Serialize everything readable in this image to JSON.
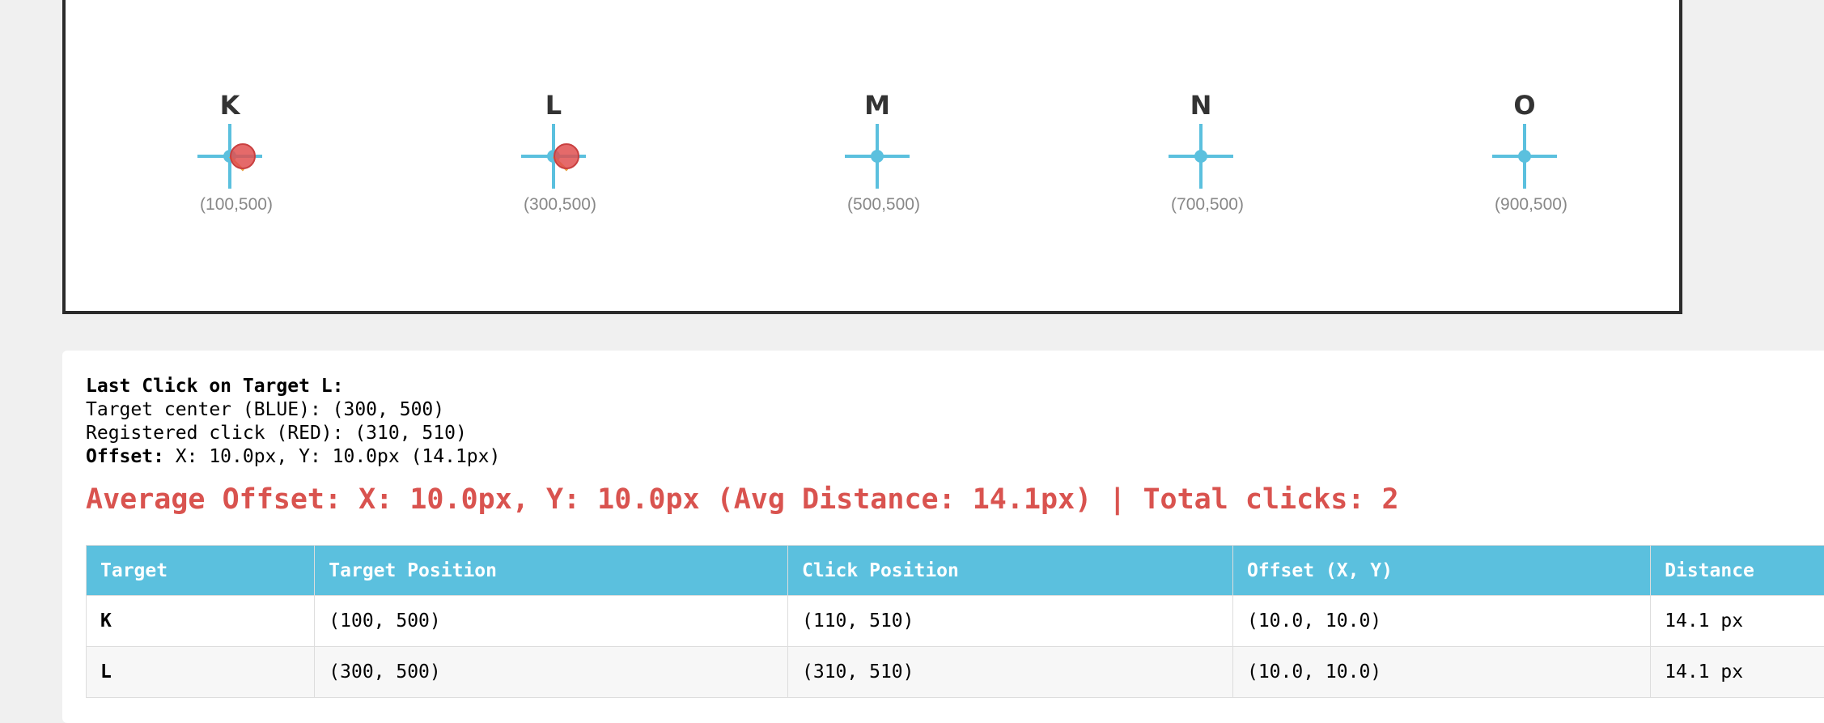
{
  "targets": [
    {
      "letter": "K",
      "coords": "(100,500)"
    },
    {
      "letter": "L",
      "coords": "(300,500)"
    },
    {
      "letter": "M",
      "coords": "(500,500)"
    },
    {
      "letter": "N",
      "coords": "(700,500)"
    },
    {
      "letter": "O",
      "coords": "(900,500)"
    }
  ],
  "colors": {
    "target": "#5bc0de",
    "click": "#e05050",
    "accent_red": "#d9534f",
    "header_bg": "#5bc0de"
  },
  "last_click": {
    "heading": "Last Click on Target L:",
    "target_center": "Target center (BLUE): (300, 500)",
    "registered_click": "Registered click (RED): (310, 510)",
    "offset_label": "Offset:",
    "offset_value": " X: 10.0px, Y: 10.0px (14.1px)"
  },
  "average": "Average Offset: X: 10.0px, Y: 10.0px (Avg Distance: 14.1px) | Total clicks: 2",
  "table": {
    "headers": [
      "Target",
      "Target Position",
      "Click Position",
      "Offset (X, Y)",
      "Distance"
    ],
    "rows": [
      [
        "K",
        "(100, 500)",
        "(110, 510)",
        "(10.0, 10.0)",
        "14.1 px"
      ],
      [
        "L",
        "(300, 500)",
        "(310, 510)",
        "(10.0, 10.0)",
        "14.1 px"
      ]
    ]
  }
}
